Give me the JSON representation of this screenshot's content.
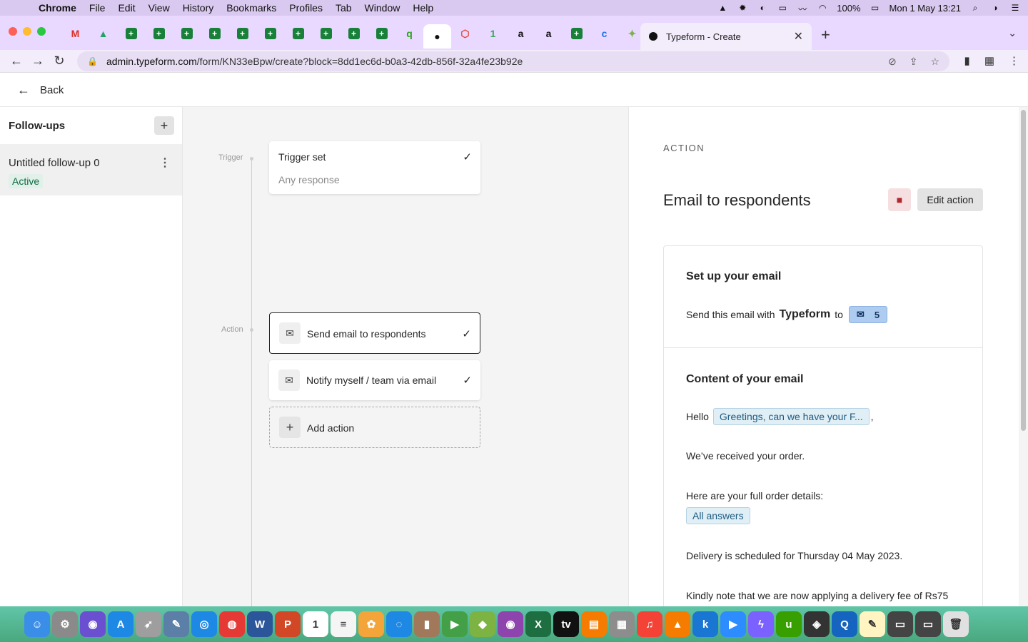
{
  "menubar": {
    "app": "Chrome",
    "items": [
      "File",
      "Edit",
      "View",
      "History",
      "Bookmarks",
      "Profiles",
      "Tab",
      "Window",
      "Help"
    ],
    "battery": "100%",
    "datetime": "Mon 1 May  13:21"
  },
  "tabs": {
    "active_title": "Typeform - Create",
    "pinned": [
      {
        "icon": "gmail-icon",
        "glyph": "M",
        "color": "#d93025"
      },
      {
        "icon": "drive-icon",
        "glyph": "▲",
        "color": "#1fa463"
      },
      {
        "icon": "sheets-icon",
        "glyph": "+",
        "color": "#188038"
      },
      {
        "icon": "sheets-icon",
        "glyph": "+",
        "color": "#188038"
      },
      {
        "icon": "sheets-icon",
        "glyph": "+",
        "color": "#188038"
      },
      {
        "icon": "sheets-icon",
        "glyph": "+",
        "color": "#188038"
      },
      {
        "icon": "sheets-icon",
        "glyph": "+",
        "color": "#188038"
      },
      {
        "icon": "sheets-icon",
        "glyph": "+",
        "color": "#188038"
      },
      {
        "icon": "sheets-icon",
        "glyph": "+",
        "color": "#188038"
      },
      {
        "icon": "sheets-icon",
        "glyph": "+",
        "color": "#188038"
      },
      {
        "icon": "sheets-icon",
        "glyph": "+",
        "color": "#188038"
      },
      {
        "icon": "sheets-icon",
        "glyph": "+",
        "color": "#188038"
      },
      {
        "icon": "quickbooks-icon",
        "glyph": "q",
        "color": "#2ca01c"
      },
      {
        "icon": "typeform-icon",
        "glyph": "●",
        "color": "#111111"
      },
      {
        "icon": "hexagon-icon",
        "glyph": "⬡",
        "color": "#e8453c"
      },
      {
        "icon": "one-icon",
        "glyph": "1",
        "color": "#3aa55b"
      },
      {
        "icon": "amazon-icon",
        "glyph": "a",
        "color": "#111111"
      },
      {
        "icon": "amazon-icon",
        "glyph": "a",
        "color": "#111111"
      },
      {
        "icon": "sheets-icon",
        "glyph": "+",
        "color": "#188038"
      },
      {
        "icon": "c-icon",
        "glyph": "c",
        "color": "#1a73e8"
      },
      {
        "icon": "bird-icon",
        "glyph": "✦",
        "color": "#7cb342"
      }
    ]
  },
  "address_bar": {
    "domain": "admin.typeform.com",
    "path": "/form/KN33eBpw/create?block=8dd1ec6d-b0a3-42db-856f-32a4fe23b92e"
  },
  "header": {
    "back_label": "Back"
  },
  "sidebar": {
    "title": "Follow-ups",
    "items": [
      {
        "name": "Untitled follow-up 0",
        "status": "Active"
      }
    ]
  },
  "flow": {
    "trigger_label": "Trigger",
    "action_label": "Action",
    "trigger_card": {
      "title": "Trigger set",
      "subtitle": "Any response"
    },
    "actions": [
      {
        "label": "Send email to respondents",
        "selected": true
      },
      {
        "label": "Notify myself / team via email",
        "selected": false
      }
    ],
    "add_action": "Add action"
  },
  "panel": {
    "section_label": "ACTION",
    "title": "Email to respondents",
    "edit_button": "Edit action",
    "setup": {
      "heading": "Set up your email",
      "send_prefix": "Send this email with",
      "brand": "Typeform",
      "to": "to",
      "recipient_count": "5"
    },
    "content": {
      "heading": "Content of your email",
      "hello": "Hello",
      "greeting_tag": "Greetings, can we have your F...",
      "comma": ",",
      "line1": "We’ve received your order.",
      "line2": "Here are your full order details:",
      "answers_tag": "All answers",
      "line3": "Delivery is scheduled for Thursday 04 May 2023.",
      "line4": "Kindly note that we are now applying a delivery fee of Rs75"
    }
  },
  "dock": [
    {
      "icon": "finder-icon",
      "glyph": "☺",
      "color": "#3b8ee8"
    },
    {
      "icon": "settings-icon",
      "glyph": "⚙",
      "color": "#8a8a8a"
    },
    {
      "icon": "siri-icon",
      "glyph": "◉",
      "color": "#6a4fd1"
    },
    {
      "icon": "app-store-icon",
      "glyph": "A",
      "color": "#1e88e5"
    },
    {
      "icon": "launchpad-icon",
      "glyph": "➶",
      "color": "#9e9e9e"
    },
    {
      "icon": "preview-icon",
      "glyph": "✎",
      "color": "#5c7fa8"
    },
    {
      "icon": "safari-icon",
      "glyph": "◎",
      "color": "#1e88e5"
    },
    {
      "icon": "chrome-icon",
      "glyph": "◍",
      "color": "#e53935"
    },
    {
      "icon": "word-icon",
      "glyph": "W",
      "color": "#2b579a"
    },
    {
      "icon": "powerpoint-icon",
      "glyph": "P",
      "color": "#d24726"
    },
    {
      "icon": "calendar-icon",
      "glyph": "1",
      "color": "#ffffff"
    },
    {
      "icon": "reminders-icon",
      "glyph": "≡",
      "color": "#f5f5f5"
    },
    {
      "icon": "photos-icon",
      "glyph": "✿",
      "color": "#f4a53a"
    },
    {
      "icon": "messages-icon",
      "glyph": "◌",
      "color": "#1e88e5"
    },
    {
      "icon": "contacts-icon",
      "glyph": "▮",
      "color": "#a1795a"
    },
    {
      "icon": "facetime-icon",
      "glyph": "▶",
      "color": "#43a047"
    },
    {
      "icon": "maps-icon",
      "glyph": "◆",
      "color": "#7cb342"
    },
    {
      "icon": "podcasts-icon",
      "glyph": "◉",
      "color": "#8e44ad"
    },
    {
      "icon": "excel-icon",
      "glyph": "X",
      "color": "#1d6f42"
    },
    {
      "icon": "tv-icon",
      "glyph": "tv",
      "color": "#111111"
    },
    {
      "icon": "books-icon",
      "glyph": "▤",
      "color": "#f57c00"
    },
    {
      "icon": "notes-icon",
      "glyph": "▦",
      "color": "#8d8d8d"
    },
    {
      "icon": "music-icon",
      "glyph": "♫",
      "color": "#f44336"
    },
    {
      "icon": "vlc-icon",
      "glyph": "▲",
      "color": "#f57c00"
    },
    {
      "icon": "k-icon",
      "glyph": "k",
      "color": "#1976d2"
    },
    {
      "icon": "zoom-icon",
      "glyph": "▶",
      "color": "#2d8cff"
    },
    {
      "icon": "messenger-icon",
      "glyph": "ϟ",
      "color": "#7b61ff"
    },
    {
      "icon": "upwork-icon",
      "glyph": "u",
      "color": "#37a000"
    },
    {
      "icon": "aperture-icon",
      "glyph": "◈",
      "color": "#333333"
    },
    {
      "icon": "quicktime-icon",
      "glyph": "Q",
      "color": "#1565c0"
    },
    {
      "icon": "notes-paper-icon",
      "glyph": "✎",
      "color": "#fff4c2"
    },
    {
      "icon": "screens-icon",
      "glyph": "▭",
      "color": "#444444"
    },
    {
      "icon": "screens-icon",
      "glyph": "▭",
      "color": "#444444"
    },
    {
      "icon": "trash-icon",
      "glyph": "🗑",
      "color": "#e0e0e0"
    }
  ]
}
